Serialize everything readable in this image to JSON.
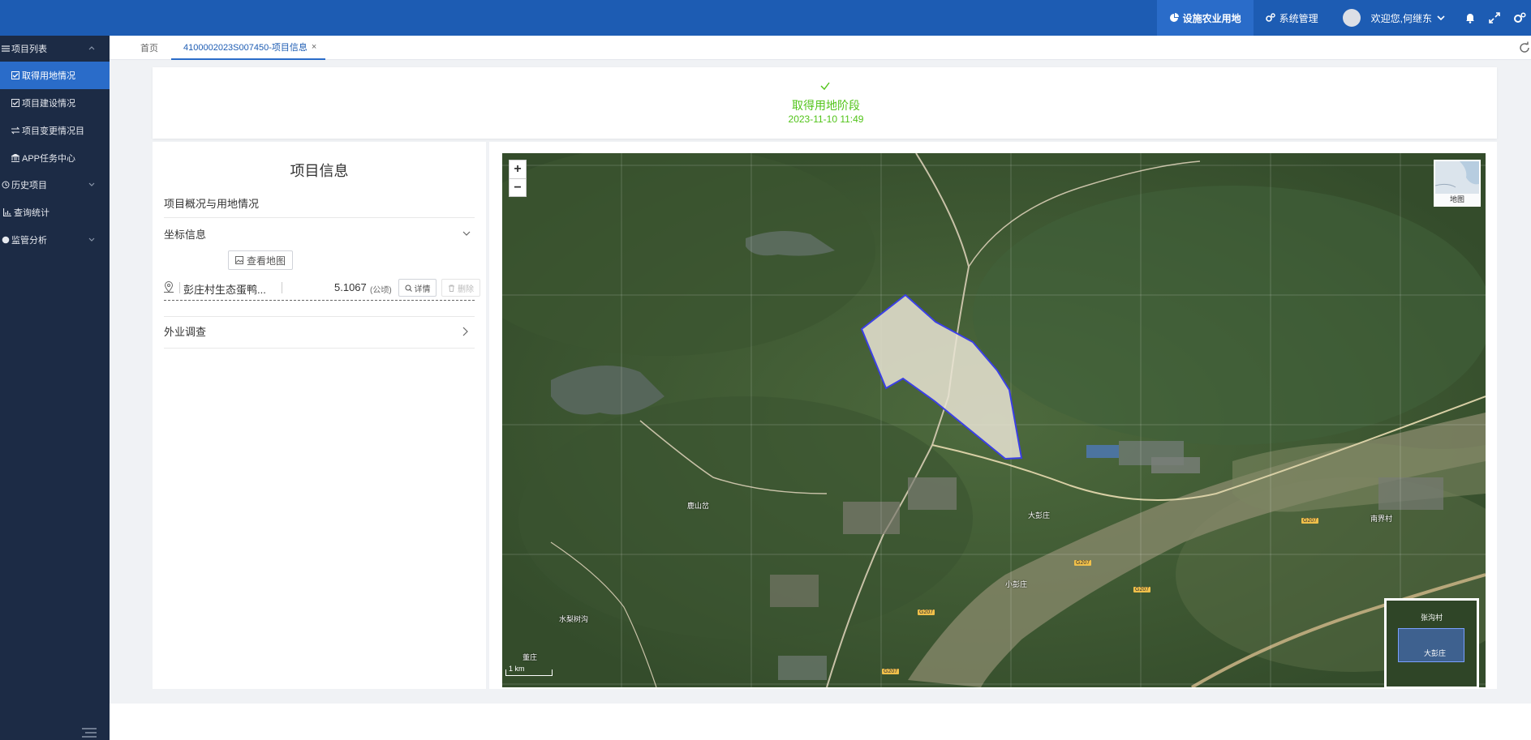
{
  "topnav": {
    "facility_land": "设施农业用地",
    "system_admin": "系统管理",
    "welcome": "欢迎您,何继东"
  },
  "sidebar": {
    "groups": [
      {
        "label": "项目列表"
      },
      {
        "label": "历史项目"
      },
      {
        "label": "查询统计"
      },
      {
        "label": "监管分析"
      }
    ],
    "items": [
      {
        "label": "取得用地情况"
      },
      {
        "label": "项目建设情况"
      },
      {
        "label": "项目变更情况目"
      },
      {
        "label": "APP任务中心"
      }
    ]
  },
  "tabs": {
    "home": "首页",
    "active": "4100002023S007450-项目信息",
    "close": "×"
  },
  "stage": {
    "title": "取得用地阶段",
    "time": "2023-11-10 11:49"
  },
  "info": {
    "title": "项目信息",
    "overview": "项目概况与用地情况",
    "coord": "坐标信息",
    "view_map": "查看地图",
    "parcel": {
      "name": "彭庄村生态蛋鸭...",
      "area": "5.1067",
      "unit": "(公顷)",
      "detail": "详情",
      "delete": "删除"
    },
    "field_survey": "外业调查"
  },
  "map": {
    "zoom_in": "+",
    "zoom_out": "−",
    "layer_label": "地图",
    "scale": "1 km",
    "overview_labels": [
      "张沟村",
      "大彭庄"
    ],
    "place_labels": [
      "鹿山岔",
      "大彭庄",
      "小彭庄",
      "水梨树沟",
      "董庄",
      "南界村"
    ],
    "road_badges": [
      "G207",
      "G207",
      "G207",
      "G207",
      "G207"
    ]
  },
  "colors": {
    "topbar": "#1d5cb3",
    "sidebar": "#1c2b45",
    "accent": "#2a6cc9",
    "success": "#52c41a",
    "parcel_outline": "#3b3fe6"
  }
}
